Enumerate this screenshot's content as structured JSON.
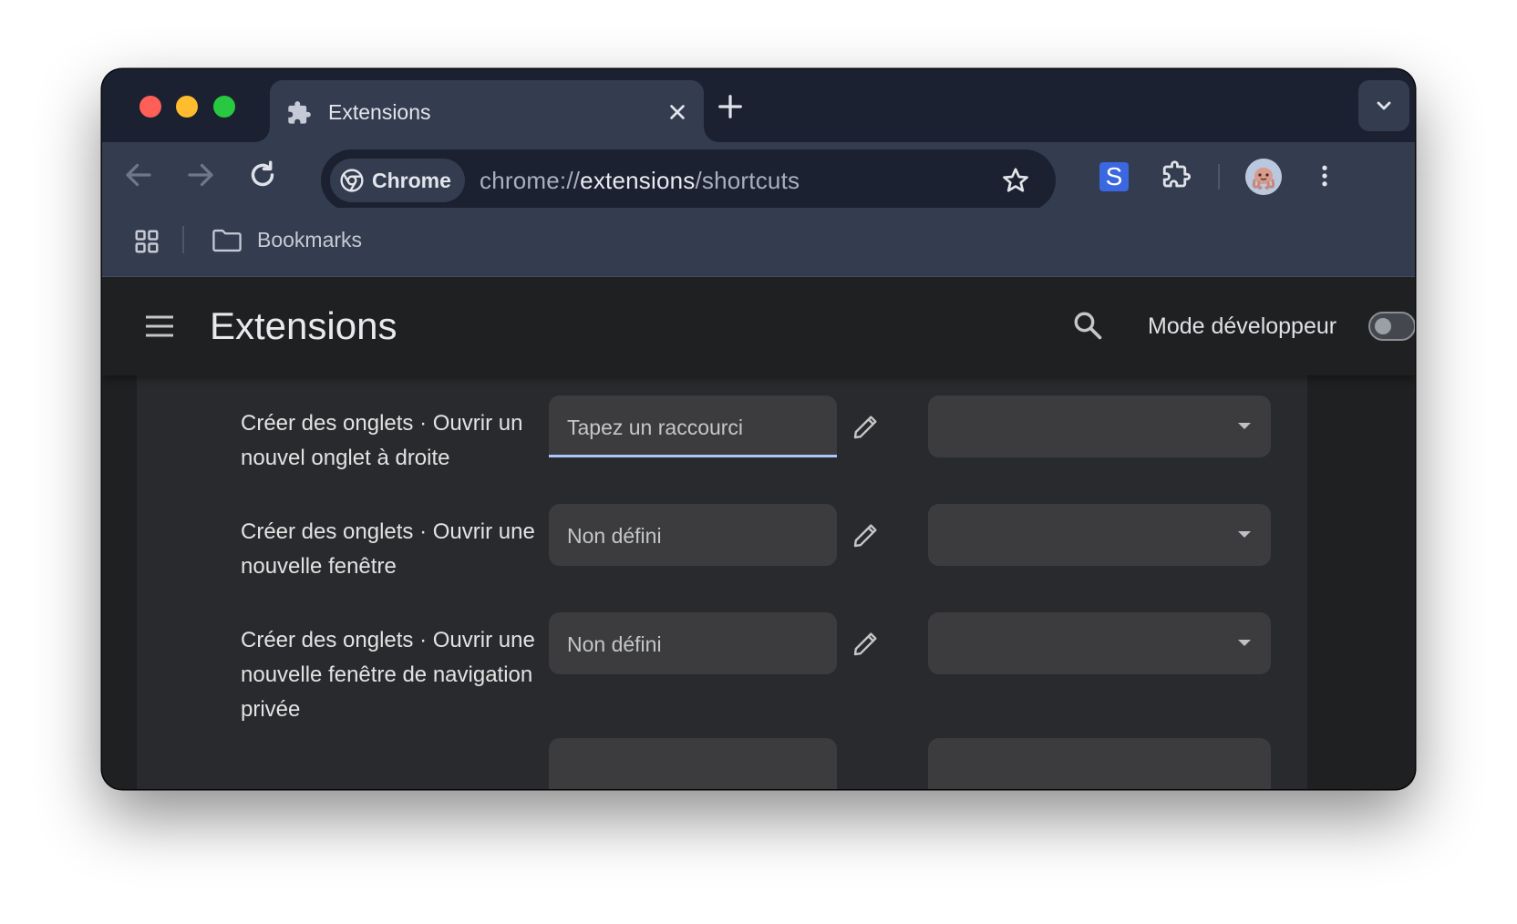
{
  "tab": {
    "title": "Extensions"
  },
  "omnibox": {
    "chip_label": "Chrome",
    "url_scheme": "chrome://",
    "url_host": "extensions",
    "url_path": "/shortcuts"
  },
  "toolbar": {
    "extension_s_label": "S"
  },
  "bookmarks": {
    "folder_label": "Bookmarks"
  },
  "header": {
    "title": "Extensions",
    "dev_mode_label": "Mode développeur",
    "dev_mode_on": false
  },
  "shortcuts": [
    {
      "label": "Créer des onglets · Ouvrir un nouvel onglet à droite",
      "field": "Tapez un raccourci",
      "active": true,
      "scope": ""
    },
    {
      "label": "Créer des onglets · Ouvrir une nouvelle fenêtre",
      "field": "Non défini",
      "active": false,
      "scope": ""
    },
    {
      "label": "Créer des onglets · Ouvrir une nouvelle fenêtre de navigation privée",
      "field": "Non défini",
      "active": false,
      "scope": ""
    }
  ],
  "colors": {
    "tabstrip_bg": "#1b2131",
    "toolbar_bg": "#343c4f",
    "page_bg": "#1f2021",
    "card_bg": "#292a2d",
    "focus_underline": "#a8c7fa",
    "extension_s_bg": "#3b67e0"
  }
}
